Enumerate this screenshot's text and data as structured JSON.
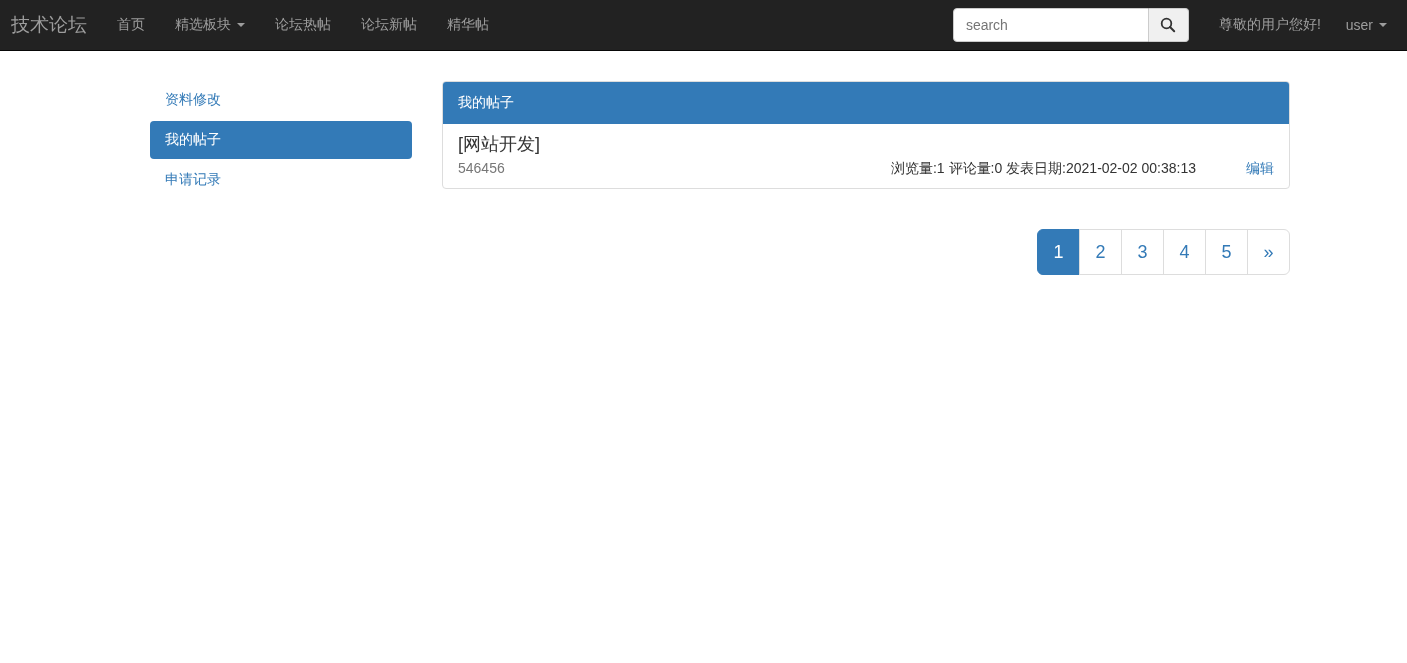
{
  "navbar": {
    "brand": "技术论坛",
    "items": [
      {
        "label": "首页",
        "dropdown": false
      },
      {
        "label": "精选板块",
        "dropdown": true
      },
      {
        "label": "论坛热帖",
        "dropdown": false
      },
      {
        "label": "论坛新帖",
        "dropdown": false
      },
      {
        "label": "精华帖",
        "dropdown": false
      }
    ],
    "search": {
      "placeholder": "search"
    },
    "greeting": "尊敬的用户您好!",
    "user_menu": {
      "label": "user",
      "dropdown": true
    }
  },
  "sidebar": {
    "items": [
      {
        "label": "资料修改",
        "selected": false
      },
      {
        "label": "我的帖子",
        "selected": true
      },
      {
        "label": "申请记录",
        "selected": false
      }
    ]
  },
  "panel": {
    "title": "我的帖子",
    "posts": [
      {
        "title": "[网站开发]",
        "content": "546456",
        "meta": "浏览量:1 评论量:0 发表日期:2021-02-02 00:38:13",
        "action": "编辑"
      }
    ]
  },
  "pagination": [
    {
      "label": "1",
      "selected": true
    },
    {
      "label": "2",
      "selected": false
    },
    {
      "label": "3",
      "selected": false
    },
    {
      "label": "4",
      "selected": false
    },
    {
      "label": "5",
      "selected": false
    },
    {
      "label": "»",
      "selected": false
    }
  ]
}
